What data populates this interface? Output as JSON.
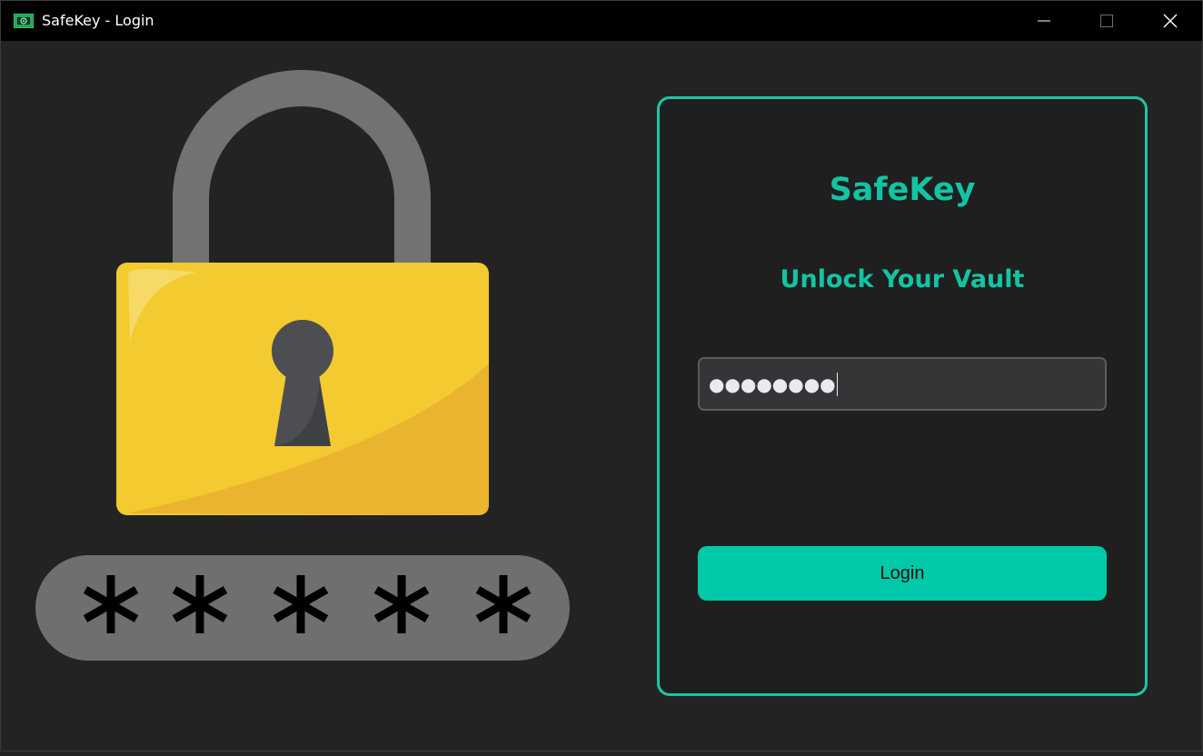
{
  "window": {
    "title": "SafeKey - Login",
    "app_icon": "safe-icon",
    "controls": [
      "minimize-icon",
      "maximize-icon",
      "close-icon"
    ]
  },
  "illustration": {
    "icon": "padlock-icon",
    "password_mask": "* * * * *",
    "colors": {
      "shackle": "#737270",
      "lock_body": "#f3ca30",
      "lock_shade": "#ebb42f",
      "keyhole": "#4d4e51",
      "mask_pill": "#706f6d"
    }
  },
  "login": {
    "title": "SafeKey",
    "subtitle": "Unlock Your Vault",
    "password_value": "●●●●●●●●",
    "button_label": "Login"
  },
  "colors": {
    "accent": "#12c4a3",
    "button": "#00c8a8",
    "background": "#232323",
    "titlebar": "#000000"
  }
}
